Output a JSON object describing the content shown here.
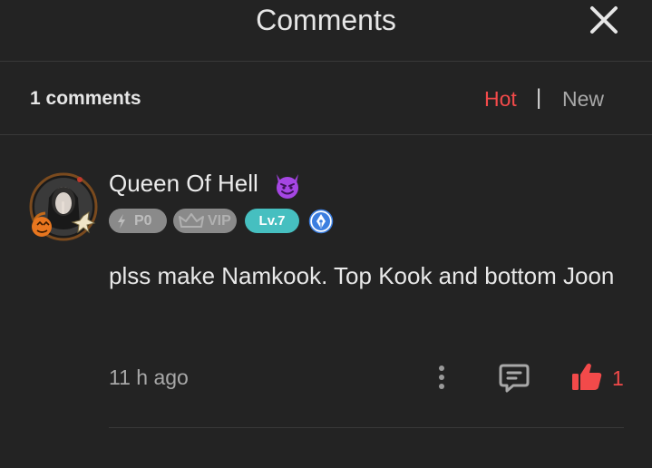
{
  "header": {
    "title": "Comments",
    "close_icon": "close-icon"
  },
  "comments_bar": {
    "count_label": "1 comments",
    "sort_hot": "Hot",
    "sort_separator": "|",
    "sort_new": "New",
    "active_sort_color": "#f24a4a"
  },
  "comment": {
    "username": "Queen Of Hell",
    "username_emoji": "smiling-devil-emoji",
    "badges": {
      "p_label": "P0",
      "vip_label": "VIP",
      "level_label": "Lv.7",
      "pen_icon": "pen-nib-icon"
    },
    "text": "plss make Namkook. Top Kook and bottom Joon",
    "time": "11 h ago",
    "like_count": "1",
    "actions": [
      "more-options-icon",
      "reply-icon",
      "thumbs-up-icon"
    ]
  },
  "colors": {
    "background": "#232323",
    "accent": "#f24a4a",
    "level_badge": "#46bfc0",
    "divider": "#383838"
  }
}
